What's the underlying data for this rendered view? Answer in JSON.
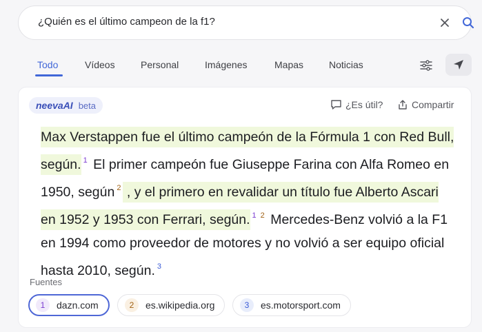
{
  "search": {
    "query": "¿Quién es el último campeon de la f1?"
  },
  "tabs": [
    {
      "label": "Todo",
      "active": true
    },
    {
      "label": "Vídeos"
    },
    {
      "label": "Personal"
    },
    {
      "label": "Imágenes"
    },
    {
      "label": "Mapas"
    },
    {
      "label": "Noticias"
    }
  ],
  "icons": {
    "clear": "close-icon",
    "search": "search-icon",
    "filter": "sliders-icon",
    "location": "location-arrow-icon",
    "useful": "chat-bubble-icon",
    "share": "share-icon"
  },
  "card": {
    "brand_name": "neevaAI",
    "brand_tag": "beta",
    "useful_label": "¿Es útil?",
    "share_label": "Compartir",
    "answer": {
      "s1": "Max Verstappen fue el último campeón de la Fórmula 1 con Red Bull, según.",
      "s1_ref": "1",
      "s2": " El primer campeón fue Giuseppe Farina con Alfa Romeo en 1950, según",
      "s2_ref": "2",
      "s3": " , y el primero en revalidar un título fue Alberto Ascari en 1952 y 1953 con Ferrari, según.",
      "s3_ref_a": "1",
      "s3_ref_b": "2",
      "s4": " Mercedes-Benz volvió a la F1 en 1994 como proveedor de motores y no volvió a ser equipo oficial hasta 2010, según.",
      "s4_ref": "3"
    },
    "sources_label": "Fuentes",
    "sources": [
      {
        "num": "1",
        "domain": "dazn.com"
      },
      {
        "num": "2",
        "domain": "es.wikipedia.org"
      },
      {
        "num": "3",
        "domain": "es.motorsport.com"
      }
    ]
  },
  "colors": {
    "accent": "#4167d8",
    "highlight": "#f0f8dc",
    "ref1": "#7a3bd0",
    "ref2": "#a06114",
    "ref3": "#3b5bd6"
  }
}
